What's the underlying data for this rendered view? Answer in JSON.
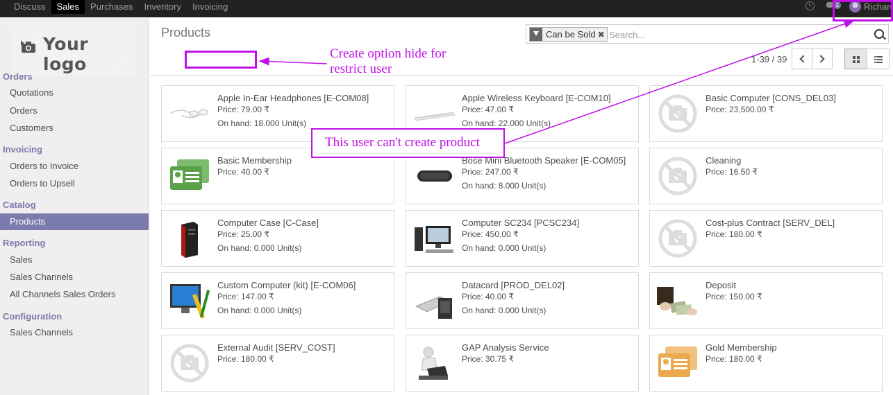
{
  "topbar": {
    "apps": [
      "Discuss",
      "Sales",
      "Purchases",
      "Inventory",
      "Invoicing"
    ],
    "active_app": "Sales",
    "chat_count": "1",
    "user_name": "Richard"
  },
  "sidebar": {
    "logo_text": "Your logo",
    "sections": [
      {
        "title": "Orders",
        "items": [
          "Quotations",
          "Orders",
          "Customers"
        ]
      },
      {
        "title": "Invoicing",
        "items": [
          "Orders to Invoice",
          "Orders to Upsell"
        ]
      },
      {
        "title": "Catalog",
        "items": [
          "Products"
        ]
      },
      {
        "title": "Reporting",
        "items": [
          "Sales",
          "Sales Channels",
          "All Channels Sales Orders"
        ]
      },
      {
        "title": "Configuration",
        "items": [
          "Sales Channels"
        ]
      }
    ],
    "active_item": "Products"
  },
  "control_panel": {
    "title": "Products",
    "search_facet": "Can be Sold",
    "search_placeholder": "Search...",
    "pager": "1-39 / 39"
  },
  "annotations": {
    "create_hidden": "Create option hide for restrict user",
    "cannot_create": "This user can't create product"
  },
  "products": [
    {
      "name": "Apple In-Ear Headphones [E-COM08]",
      "price": "Price: 79.00 ₹",
      "onhand": "On hand: 18.000 Unit(s)",
      "image": "headphones"
    },
    {
      "name": "Apple Wireless Keyboard [E-COM10]",
      "price": "Price: 47.00 ₹",
      "onhand": "On hand: 22.000 Unit(s)",
      "image": "keyboard"
    },
    {
      "name": "Basic Computer [CONS_DEL03]",
      "price": "Price: 23,500.00 ₹",
      "onhand": "",
      "image": "no-image"
    },
    {
      "name": "Basic Membership",
      "price": "Price: 40.00 ₹",
      "onhand": "",
      "image": "membership-green"
    },
    {
      "name": "Bose Mini Bluetooth Speaker [E-COM05]",
      "price": "Price: 247.00 ₹",
      "onhand": "On hand: 8.000 Unit(s)",
      "image": "speaker"
    },
    {
      "name": "Cleaning",
      "price": "Price: 16.50 ₹",
      "onhand": "",
      "image": "no-image"
    },
    {
      "name": "Computer Case [C-Case]",
      "price": "Price: 25.00 ₹",
      "onhand": "On hand: 0.000 Unit(s)",
      "image": "computer-case"
    },
    {
      "name": "Computer SC234 [PCSC234]",
      "price": "Price: 450.00 ₹",
      "onhand": "On hand: 0.000 Unit(s)",
      "image": "desktop"
    },
    {
      "name": "Cost-plus Contract [SERV_DEL]",
      "price": "Price: 180.00 ₹",
      "onhand": "",
      "image": "no-image"
    },
    {
      "name": "Custom Computer (kit) [E-COM06]",
      "price": "Price: 147.00 ₹",
      "onhand": "On hand: 0.000 Unit(s)",
      "image": "computer-kit"
    },
    {
      "name": "Datacard [PROD_DEL02]",
      "price": "Price: 40.00 ₹",
      "onhand": "On hand: 0.000 Unit(s)",
      "image": "datacard"
    },
    {
      "name": "Deposit",
      "price": "Price: 150.00 ₹",
      "onhand": "",
      "image": "money"
    },
    {
      "name": "External Audit [SERV_COST]",
      "price": "Price: 180.00 ₹",
      "onhand": "",
      "image": "no-image"
    },
    {
      "name": "GAP Analysis Service",
      "price": "Price: 30.75 ₹",
      "onhand": "",
      "image": "laptop-figure"
    },
    {
      "name": "Gold Membership",
      "price": "Price: 180.00 ₹",
      "onhand": "",
      "image": "membership-orange"
    }
  ],
  "colors": {
    "accent": "#7c7bad",
    "annotation": "#c010e8",
    "topbar": "#222222"
  }
}
